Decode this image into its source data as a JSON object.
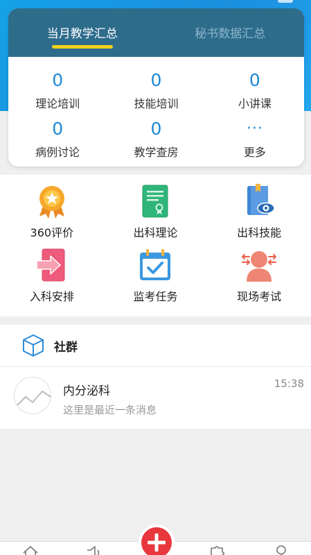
{
  "header": {
    "tabs": [
      {
        "label": "当月教学汇总",
        "active": true
      },
      {
        "label": "秘书数据汇总",
        "active": false
      }
    ],
    "accent_color": "#f3d21b"
  },
  "stats": [
    {
      "value": "0",
      "label": "理论培训"
    },
    {
      "value": "0",
      "label": "技能培训"
    },
    {
      "value": "0",
      "label": "小讲课"
    },
    {
      "value": "0",
      "label": "病例讨论"
    },
    {
      "value": "0",
      "label": "教学查房"
    },
    {
      "value": "···",
      "label": "更多"
    }
  ],
  "functions": [
    {
      "label": "360评价",
      "icon": "award-medal-icon"
    },
    {
      "label": "出科理论",
      "icon": "certificate-document-icon"
    },
    {
      "label": "出科技能",
      "icon": "skill-book-eye-icon"
    },
    {
      "label": "入科安排",
      "icon": "enter-arrow-icon"
    },
    {
      "label": "监考任务",
      "icon": "calendar-check-icon"
    },
    {
      "label": "现场考试",
      "icon": "person-exam-icon"
    }
  ],
  "community": {
    "title": "社群",
    "icon": "cube-icon",
    "message": {
      "name": "内分泌科",
      "preview": "这里是最近一条消息",
      "time": "15:38",
      "avatar": "chart-line-avatar"
    }
  },
  "bottom_nav": {
    "items": [
      "home-icon",
      "speaker-icon",
      "add-icon",
      "puzzle-icon",
      "location-pin-icon"
    ],
    "fab_color": "#e8383d"
  }
}
